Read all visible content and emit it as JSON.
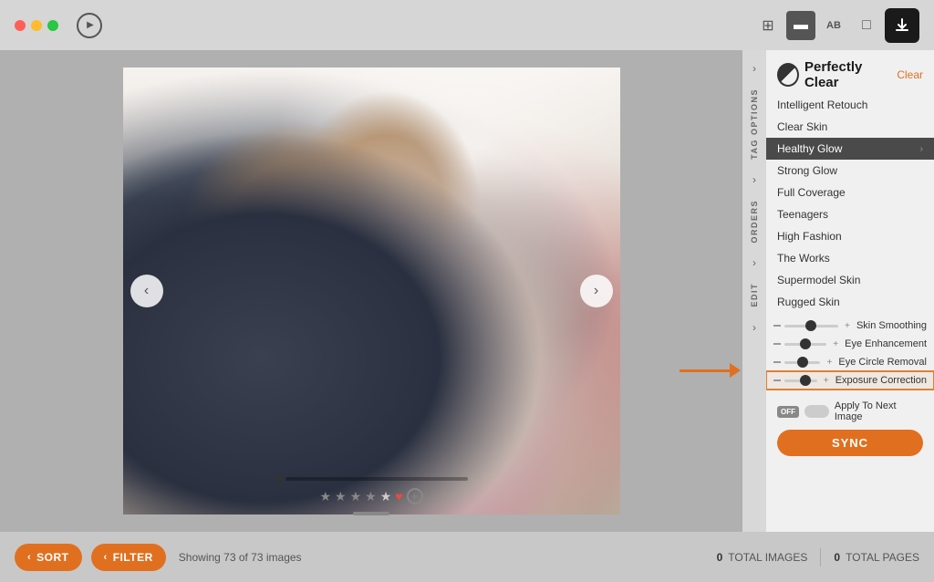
{
  "titlebar": {
    "play_label": "▶",
    "view_modes": [
      "⊞",
      "▬",
      "AB",
      "□"
    ],
    "active_view": 1,
    "download_icon": "↓"
  },
  "presets": {
    "header": "Perfectly Clear",
    "clear_label": "Clear",
    "items": [
      {
        "label": "Intelligent Retouch",
        "active": false
      },
      {
        "label": "Clear Skin",
        "active": false
      },
      {
        "label": "Healthy Glow",
        "active": true
      },
      {
        "label": "Strong Glow",
        "active": false
      },
      {
        "label": "Full Coverage",
        "active": false
      },
      {
        "label": "Teenagers",
        "active": false
      },
      {
        "label": "High Fashion",
        "active": false
      },
      {
        "label": "The Works",
        "active": false
      },
      {
        "label": "Supermodel Skin",
        "active": false
      },
      {
        "label": "Rugged Skin",
        "active": false
      }
    ]
  },
  "sliders": [
    {
      "label": "Skin Smoothing",
      "value": 0.5,
      "highlighted": false
    },
    {
      "label": "Eye Enhancement",
      "value": 0.5,
      "highlighted": false
    },
    {
      "label": "Eye Circle Removal",
      "value": 0.5,
      "highlighted": false
    },
    {
      "label": "Exposure Correction",
      "value": 0.65,
      "highlighted": true
    }
  ],
  "sync": {
    "apply_label": "Apply To Next Image",
    "off_label": "OFF",
    "sync_label": "SYNC"
  },
  "sidebar_tabs": [
    {
      "label": "TAG OPTIONS"
    },
    {
      "label": "ORDERS"
    },
    {
      "label": "EDIT"
    }
  ],
  "bottom_bar": {
    "sort_label": "SORT",
    "filter_label": "FILTER",
    "showing_text": "Showing 73 of 73 images",
    "total_images_label": "TOTAL IMAGES",
    "total_pages_label": "TOTAL PAGES",
    "total_images_count": "0",
    "total_pages_count": "0"
  },
  "photo": {
    "stars": [
      "★",
      "★",
      "★",
      "★",
      "★"
    ],
    "heart": "♥",
    "plus": "+"
  }
}
